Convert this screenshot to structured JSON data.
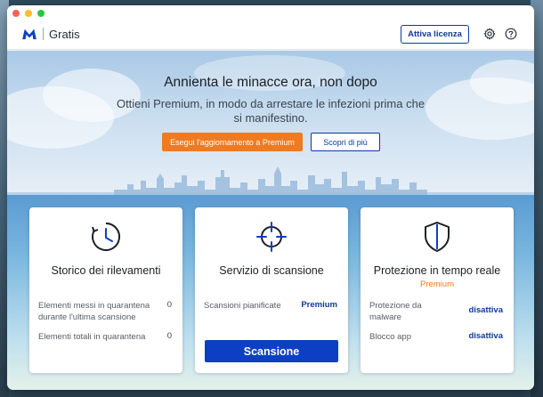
{
  "app": {
    "edition": "Gratis",
    "license_button": "Attiva licenza",
    "icons": {
      "logo": "malwarebytes-logo",
      "settings": "gear-icon",
      "help": "help-icon"
    }
  },
  "banner": {
    "headline": "Annienta le minacce ora, non dopo",
    "subline": "Ottieni Premium, in modo da arrestare le infezioni prima che si manifestino.",
    "upgrade_button": "Esegui l'aggiornamento a Premium",
    "discover_button": "Scopri di più"
  },
  "cards": {
    "history": {
      "icon": "clock-icon",
      "title": "Storico dei rilevamenti",
      "rows": [
        {
          "label": "Elementi messi in quarantena durante l'ultima scansione",
          "value": "0"
        },
        {
          "label": "Elementi totali in quarantena",
          "value": "0"
        }
      ]
    },
    "scan": {
      "icon": "crosshair-icon",
      "title": "Servizio di scansione",
      "rows": [
        {
          "label": "Scansioni pianificate",
          "value": "Premium"
        }
      ],
      "button": "Scansione"
    },
    "protection": {
      "icon": "shield-icon",
      "title": "Protezione in tempo reale",
      "tag": "Premium",
      "rows": [
        {
          "label": "Protezione da malware",
          "value": "disattiva"
        },
        {
          "label": "Blocco app",
          "value": "disattiva"
        }
      ]
    }
  },
  "colors": {
    "accent_blue": "#0d3a9c",
    "scan_blue": "#0d3fc5",
    "orange": "#f07a20"
  }
}
